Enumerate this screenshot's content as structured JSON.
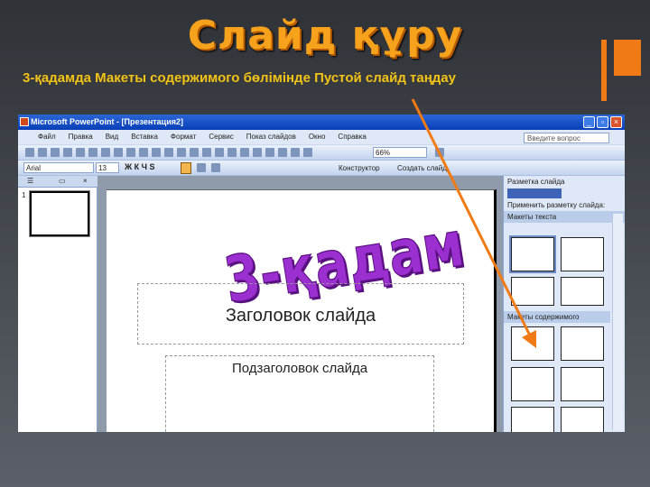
{
  "slide": {
    "title": "Слайд құру",
    "subtitle": "3-қадамда Макеты содержимого бөлімінде Пустой слайд таңдау",
    "wordart": "3-қадам",
    "accent": "#f07b16"
  },
  "window": {
    "title": "Microsoft PowerPoint - [Презентация2]",
    "menu": [
      "Файл",
      "Правка",
      "Вид",
      "Вставка",
      "Формат",
      "Сервис",
      "Показ слайдов",
      "Окно",
      "Справка"
    ],
    "ask_placeholder": "Введите вопрос",
    "font": "Arial",
    "size": "13",
    "zoom": "66%",
    "designer": "Конструктор",
    "new_slide": "Создать слайд",
    "slide_number": "1",
    "placeholders": {
      "title": "Заголовок слайда",
      "subtitle": "Подзаголовок слайда"
    },
    "taskpane": {
      "title": "Разметка слайда",
      "apply": "Применить разметку слайда:",
      "section_text": "Макеты текста",
      "section_content": "Макеты содержимого"
    }
  }
}
